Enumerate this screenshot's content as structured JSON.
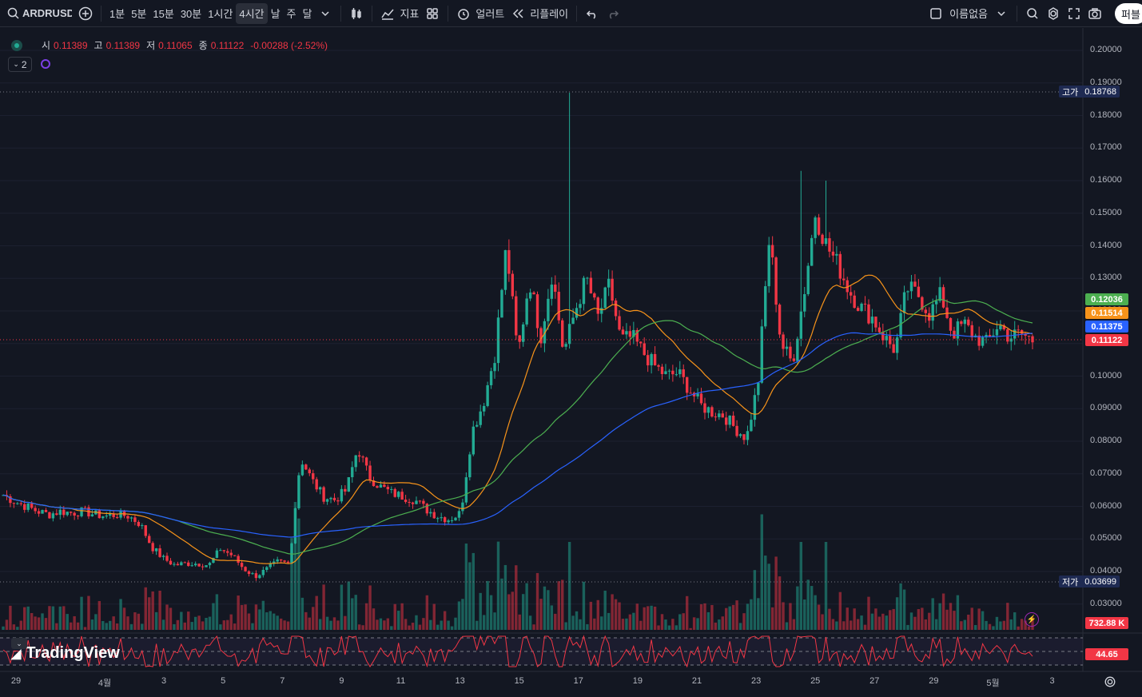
{
  "toolbar": {
    "symbol": "ARDRUSD",
    "intervals": [
      "1분",
      "5분",
      "15분",
      "30분",
      "1시간",
      "4시간",
      "날",
      "주",
      "달"
    ],
    "active_interval": "4시간",
    "indicators_label": "지표",
    "alerts_label": "얼러트",
    "replay_label": "리플레이",
    "layout_name": "이름없음",
    "publish_label": "퍼블"
  },
  "legend": {
    "open_label": "시",
    "open": "0.11389",
    "high_label": "고",
    "high": "0.11389",
    "low_label": "저",
    "low": "0.11065",
    "close_label": "종",
    "close": "0.11122",
    "change": "-0.00288 (-2.52%)",
    "collapsed_count": "2"
  },
  "price_axis": {
    "ticks": [
      "0.20000",
      "0.19000",
      "0.18000",
      "0.17000",
      "0.16000",
      "0.15000",
      "0.14000",
      "0.13000",
      "0.12000",
      "0.11000",
      "0.10000",
      "0.09000",
      "0.08000",
      "0.07000",
      "0.06000",
      "0.05000",
      "0.04000",
      "0.03000"
    ],
    "high_label": "고가",
    "high_value": "0.18768",
    "low_label": "저가",
    "low_value": "0.03699",
    "tags": [
      {
        "value": "0.12036",
        "color": "#4caf50"
      },
      {
        "value": "0.11514",
        "color": "#f7931a"
      },
      {
        "value": "0.11375",
        "color": "#2962ff"
      },
      {
        "value": "0.11122",
        "color": "#f23645"
      }
    ],
    "volume_tag": "732.88 K",
    "rsi_tag": "44.65"
  },
  "time_axis": [
    "29",
    "4월",
    "3",
    "5",
    "7",
    "9",
    "11",
    "13",
    "15",
    "17",
    "19",
    "21",
    "23",
    "25",
    "27",
    "29",
    "5월",
    "3"
  ],
  "branding": "TradingView",
  "colors": {
    "up": "#22ab94",
    "down": "#f23645",
    "ma_fast": "#f7931a",
    "ma_mid": "#4caf50",
    "ma_slow": "#2962ff",
    "rsi": "#f23645"
  },
  "chart_data": {
    "type": "candlestick",
    "price_range": [
      0.025,
      0.205
    ],
    "ohlc_path": [
      0.0635,
      0.0615,
      0.06,
      0.0585,
      0.0575,
      0.0585,
      0.058,
      0.0585,
      0.0575,
      0.057,
      0.0575,
      0.057,
      0.0545,
      0.0475,
      0.044,
      0.042,
      0.0425,
      0.0425,
      0.042,
      0.047,
      0.045,
      0.041,
      0.0385,
      0.0405,
      0.043,
      0.0425,
      0.075,
      0.068,
      0.063,
      0.062,
      0.065,
      0.078,
      0.069,
      0.066,
      0.064,
      0.063,
      0.062,
      0.059,
      0.057,
      0.056,
      0.058,
      0.083,
      0.092,
      0.107,
      0.14,
      0.106,
      0.13,
      0.112,
      0.132,
      0.107,
      0.12,
      0.13,
      0.118,
      0.128,
      0.111,
      0.112,
      0.107,
      0.103,
      0.1,
      0.101,
      0.096,
      0.091,
      0.089,
      0.088,
      0.084,
      0.081,
      0.098,
      0.143,
      0.11,
      0.104,
      0.125,
      0.15,
      0.14,
      0.134,
      0.126,
      0.121,
      0.118,
      0.112,
      0.108,
      0.127,
      0.125,
      0.119,
      0.125,
      0.113,
      0.116,
      0.112,
      0.11,
      0.116,
      0.112,
      0.113,
      0.111
    ]
  }
}
